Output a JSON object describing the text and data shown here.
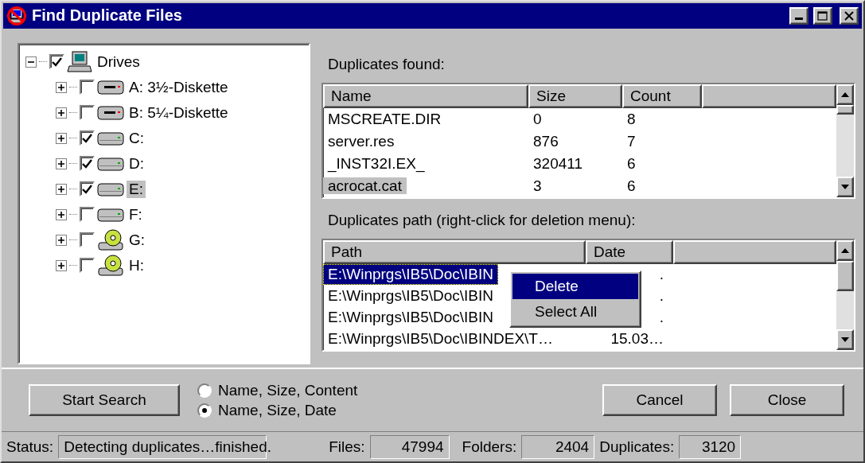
{
  "window": {
    "title": "Find Duplicate Files"
  },
  "tree": {
    "label": "Drives",
    "checked": true,
    "expanded": true,
    "kind": "computer",
    "selected": false,
    "children": [
      {
        "label": "A: 3½-Diskette",
        "checked": false,
        "expanded": false,
        "kind": "floppy",
        "selected": false
      },
      {
        "label": "B: 5¼-Diskette",
        "checked": false,
        "expanded": false,
        "kind": "floppy",
        "selected": false
      },
      {
        "label": "C:",
        "checked": true,
        "expanded": false,
        "kind": "disk",
        "selected": false
      },
      {
        "label": "D:",
        "checked": true,
        "expanded": false,
        "kind": "disk",
        "selected": false
      },
      {
        "label": "E:",
        "checked": true,
        "expanded": false,
        "kind": "disk",
        "selected": true
      },
      {
        "label": "F:",
        "checked": false,
        "expanded": false,
        "kind": "disk",
        "selected": false
      },
      {
        "label": "G:",
        "checked": false,
        "expanded": false,
        "kind": "cdrom",
        "selected": false
      },
      {
        "label": "H:",
        "checked": false,
        "expanded": false,
        "kind": "cdrom",
        "selected": false
      }
    ]
  },
  "duplicates": {
    "label": "Duplicates found:",
    "columns": [
      "Name",
      "Size",
      "Count"
    ],
    "rows": [
      {
        "cells": [
          "MSCREATE.DIR",
          "0",
          "8"
        ],
        "selected": false
      },
      {
        "cells": [
          "server.res",
          "876",
          "7"
        ],
        "selected": false
      },
      {
        "cells": [
          "_INST32I.EX_",
          "320411",
          "6"
        ],
        "selected": false
      },
      {
        "cells": [
          "acrocat.cat",
          "3",
          "6"
        ],
        "selected": true
      }
    ]
  },
  "paths": {
    "label": "Duplicates path (right-click for deletion menu):",
    "columns": [
      "Path",
      "Date"
    ],
    "rows": [
      {
        "cells": [
          "E:\\Winprgs\\IB5\\Doc\\IBIN",
          "."
        ],
        "selected": true
      },
      {
        "cells": [
          "E:\\Winprgs\\IB5\\Doc\\IBIN",
          "."
        ],
        "selected": false
      },
      {
        "cells": [
          "E:\\Winprgs\\IB5\\Doc\\IBIN",
          "."
        ],
        "selected": false
      },
      {
        "cells": [
          "E:\\Winprgs\\IB5\\Doc\\IBINDEX\\T…",
          "15.03…"
        ],
        "selected": false
      }
    ]
  },
  "context_menu": [
    {
      "label": "Delete",
      "selected": true
    },
    {
      "label": "Select All",
      "selected": false
    }
  ],
  "start_button": {
    "label": "Start Search"
  },
  "compare_options": [
    {
      "label": "Name, Size, Content",
      "selected": false
    },
    {
      "label": "Name, Size, Date",
      "selected": true
    }
  ],
  "buttons": [
    {
      "label": "Cancel"
    },
    {
      "label": "Close"
    }
  ],
  "status_bar": [
    {
      "label": "Status:",
      "value": "Detecting duplicates…finished.",
      "kind": "text"
    },
    {
      "label": "Files:",
      "value": "47994",
      "kind": "number"
    },
    {
      "label": "Folders:",
      "value": "2404",
      "kind": "number"
    },
    {
      "label": "Duplicates:",
      "value": "3120",
      "kind": "number"
    }
  ]
}
